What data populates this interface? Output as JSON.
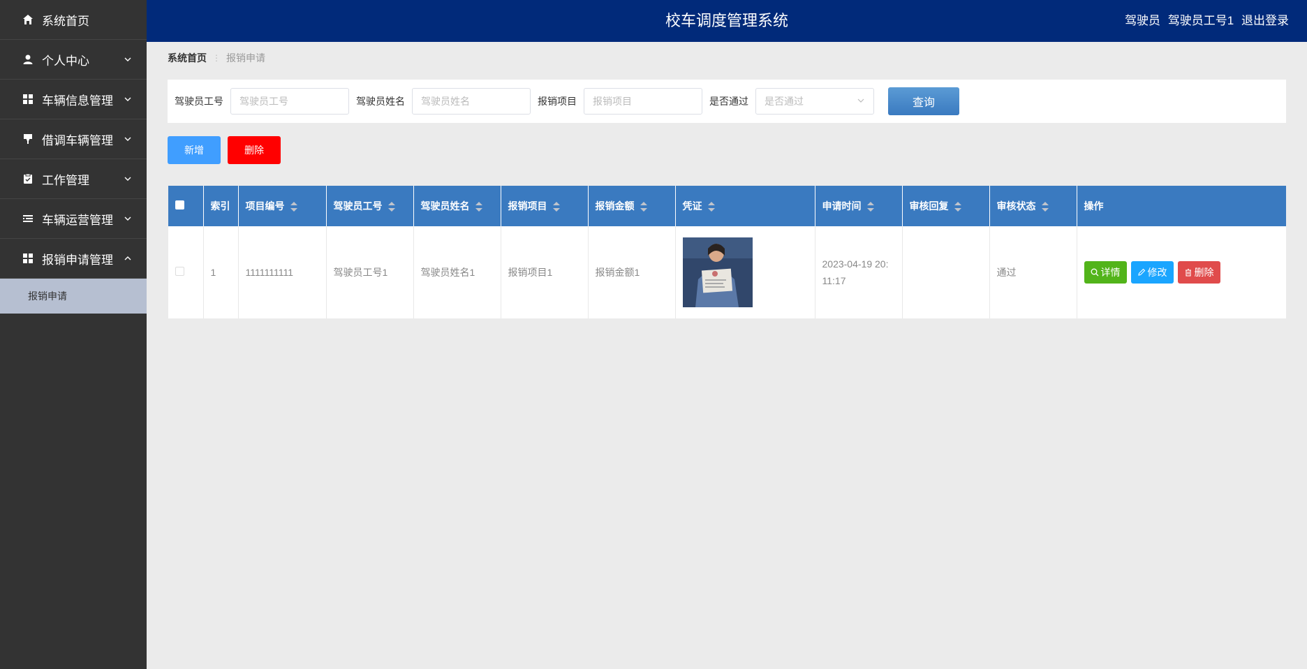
{
  "app": {
    "title": "校车调度管理系统",
    "role": "驾驶员",
    "user": "驾驶员工号1",
    "logout": "退出登录"
  },
  "sidebar": {
    "items": [
      {
        "label": "系统首页",
        "icon": "home-icon"
      },
      {
        "label": "个人中心",
        "icon": "user-icon"
      },
      {
        "label": "车辆信息管理",
        "icon": "grid-icon"
      },
      {
        "label": "借调车辆管理",
        "icon": "brush-icon"
      },
      {
        "label": "工作管理",
        "icon": "clipboard-icon"
      },
      {
        "label": "车辆运营管理",
        "icon": "list-icon"
      },
      {
        "label": "报销申请管理",
        "icon": "grid-icon"
      }
    ],
    "sub_item": "报销申请"
  },
  "breadcrumb": {
    "home": "系统首页",
    "current": "报销申请"
  },
  "search": {
    "driver_id_label": "驾驶员工号",
    "driver_id_placeholder": "驾驶员工号",
    "driver_name_label": "驾驶员姓名",
    "driver_name_placeholder": "驾驶员姓名",
    "item_label": "报销项目",
    "item_placeholder": "报销项目",
    "pass_label": "是否通过",
    "pass_placeholder": "是否通过",
    "query_button": "查询"
  },
  "actions": {
    "add": "新增",
    "delete": "删除"
  },
  "table": {
    "headers": {
      "index": "索引",
      "project_no": "项目编号",
      "driver_id": "驾驶员工号",
      "driver_name": "驾驶员姓名",
      "item": "报销项目",
      "amount": "报销金额",
      "voucher": "凭证",
      "apply_time": "申请时间",
      "reply": "审核回复",
      "status": "审核状态",
      "ops": "操作"
    },
    "rows": [
      {
        "index": "1",
        "project_no": "1111111111",
        "driver_id": "驾驶员工号1",
        "driver_name": "驾驶员姓名1",
        "item": "报销项目1",
        "amount": "报销金额1",
        "apply_time_1": "2023-04-19 20:",
        "apply_time_2": "11:17",
        "reply": "",
        "status": "通过",
        "ops": {
          "view": "详情",
          "edit": "修改",
          "delete": "删除"
        }
      }
    ]
  },
  "colors": {
    "header_bg": "#012a7a",
    "sidebar_bg": "#333333",
    "table_header": "#3a7ac0",
    "accent_blue": "#409eff",
    "danger": "#ff0000"
  }
}
